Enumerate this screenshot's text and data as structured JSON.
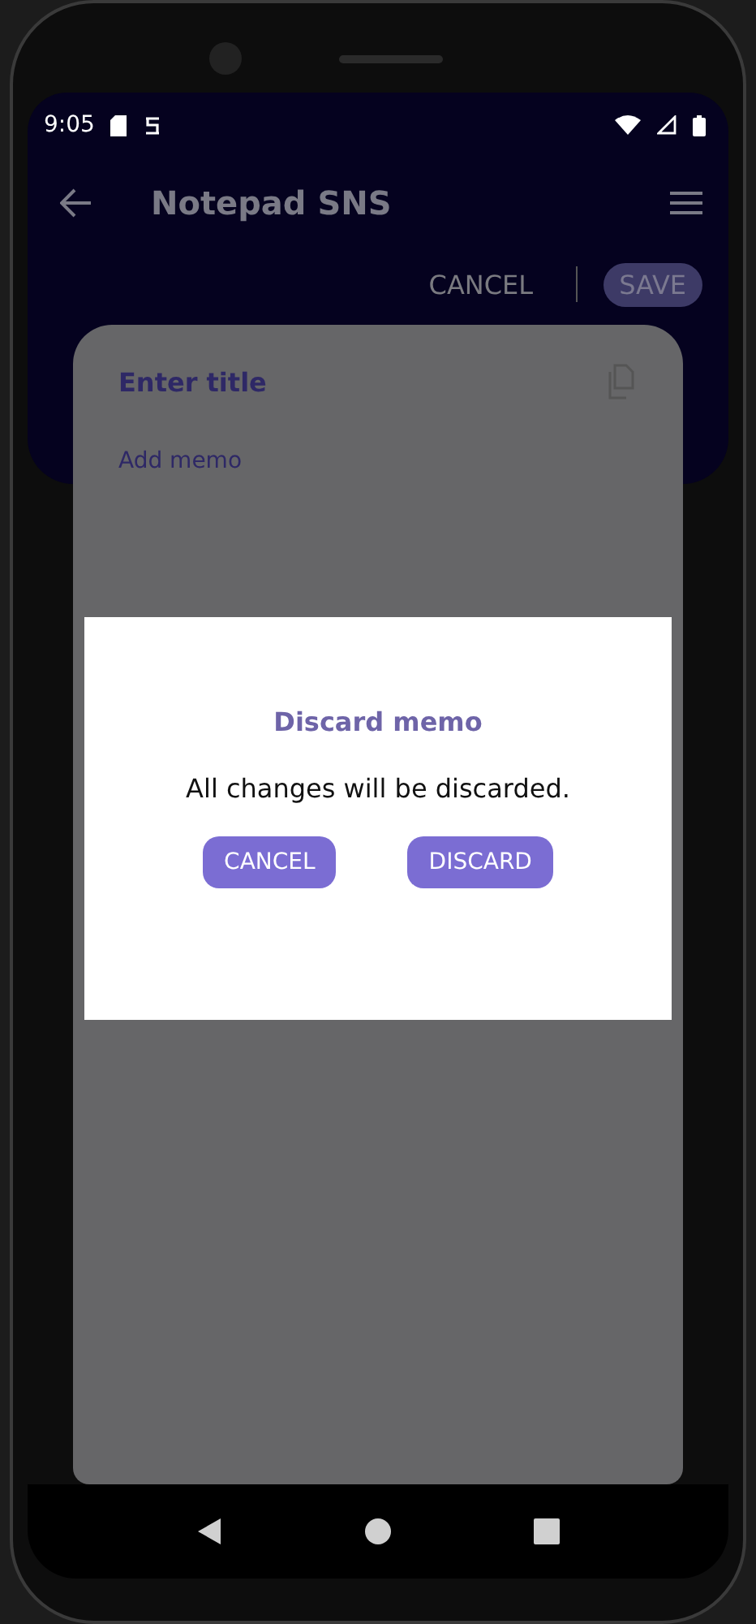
{
  "status_bar": {
    "time": "9:05"
  },
  "app_bar": {
    "title": "Notepad SNS"
  },
  "actions": [
    {
      "label": "CANCEL",
      "kind": "text"
    },
    {
      "label": "SAVE",
      "kind": "pill"
    }
  ],
  "editor": {
    "title_placeholder": "Enter title",
    "memo_placeholder": "Add memo"
  },
  "dialog": {
    "title": "Discard memo",
    "message": "All changes will be discarded.",
    "buttons": [
      "CANCEL",
      "DISCARD"
    ]
  }
}
